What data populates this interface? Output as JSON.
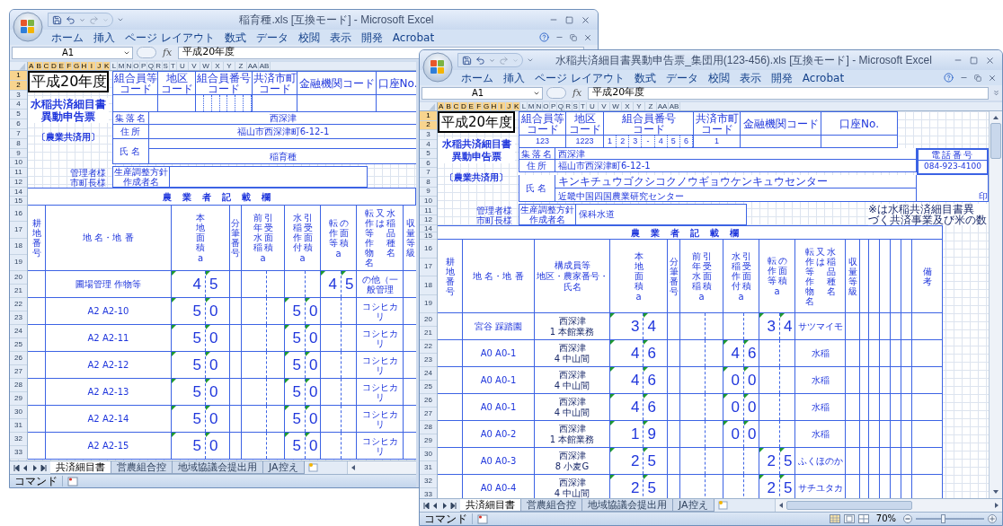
{
  "windows": [
    {
      "title": "稲育種.xls [互換モード] - Microsoft Excel",
      "ribbon_tabs": [
        "ホーム",
        "挿入",
        "ページ レイアウト",
        "数式",
        "データ",
        "校閲",
        "表示",
        "開発",
        "Acrobat"
      ],
      "name_box": "A1",
      "insert_function": "fx",
      "formula": "平成20年度",
      "columns": [
        {
          "label": "A",
          "selected": true
        },
        {
          "label": "B",
          "selected": true
        },
        {
          "label": "C",
          "selected": true
        },
        {
          "label": "D",
          "selected": true
        },
        {
          "label": "E",
          "selected": true
        },
        {
          "label": "F",
          "selected": true
        },
        {
          "label": "G",
          "selected": true
        },
        {
          "label": "H",
          "selected": true
        },
        {
          "label": "I",
          "selected": true
        },
        {
          "label": "J",
          "selected": true
        },
        {
          "label": "K",
          "selected": true
        },
        {
          "label": "L",
          "selected": false
        },
        {
          "label": "M",
          "selected": false
        },
        {
          "label": "N",
          "selected": false
        },
        {
          "label": "O",
          "selected": false
        },
        {
          "label": "P",
          "selected": false
        },
        {
          "label": "Q",
          "selected": false
        },
        {
          "label": "R",
          "selected": false
        },
        {
          "label": "S",
          "selected": false
        },
        {
          "label": "T",
          "selected": false
        },
        {
          "label": "U",
          "selected": false
        },
        {
          "label": "V",
          "selected": false
        },
        {
          "label": "W",
          "selected": false
        },
        {
          "label": "X",
          "selected": false
        },
        {
          "label": "Y",
          "selected": false
        },
        {
          "label": "Z",
          "selected": false
        },
        {
          "label": "AA",
          "selected": false
        },
        {
          "label": "AB",
          "selected": false
        }
      ],
      "sheet": {
        "kind": "individual",
        "header": {
          "rows": [
            {
              "label": "1",
              "selected": true
            },
            {
              "label": "2",
              "selected": true
            },
            {
              "label": "3",
              "selected": false
            },
            {
              "label": "4",
              "selected": false
            },
            {
              "label": "5",
              "selected": false
            },
            {
              "label": "6",
              "selected": false
            },
            {
              "label": "7",
              "selected": false
            },
            {
              "label": "8",
              "selected": false
            },
            {
              "label": "9",
              "selected": false
            },
            {
              "label": "10",
              "selected": false
            },
            {
              "label": "11",
              "selected": false
            },
            {
              "label": "12",
              "selected": false
            }
          ],
          "year": "平成20年度",
          "form_title": [
            "水稲共済細目書",
            "異動申告票"
          ],
          "form_subtitle": "〔農業共済用〕",
          "addressees": [
            "管理者様",
            "市町長様"
          ],
          "codes": [
            {
              "kind": "plain",
              "label": [
                "組合員等",
                "コード"
              ]
            },
            {
              "kind": "plain",
              "label": [
                "地区",
                "コード"
              ]
            },
            {
              "kind": "split",
              "label": [
                "組合員番号",
                "コード"
              ]
            },
            {
              "kind": "plain",
              "label": [
                "共済市町",
                "コード"
              ]
            },
            {
              "kind": "plain",
              "label": [
                "金融機関コード"
              ]
            },
            {
              "kind": "plain",
              "label": [
                "口座No."
              ]
            }
          ],
          "village": {
            "label": "集落名",
            "value": "西深津"
          },
          "address": {
            "label": "住所",
            "value": "福山市西深津町6-12-1"
          },
          "name": {
            "label": "氏名",
            "value": "稲育種"
          },
          "planner": {
            "label": [
              "生産調整方針",
              "作成者名"
            ]
          }
        },
        "title_block": {
          "rows": [
            "14",
            "15"
          ],
          "text": "農業者記載欄"
        },
        "column_headers": {
          "rows": [
            "16",
            "17",
            "18",
            "19"
          ],
          "items": [
            {
              "kind": "blank",
              "cols": [
                "耕地番号"
              ]
            },
            {
              "kind": "text",
              "lines": [
                "地 名・地 番"
              ]
            },
            {
              "kind": "digits",
              "cols": [
                "本地面積"
              ],
              "unit": "a"
            },
            {
              "kind": "blank",
              "cols": [
                "分筆番号"
              ]
            },
            {
              "kind": "digits",
              "cols": [
                "前年水稲",
                "引受面積"
              ],
              "unit": "a"
            },
            {
              "kind": "digits",
              "cols": [
                "水稲作付",
                "引受面積"
              ],
              "unit": "a"
            },
            {
              "kind": "digits",
              "cols": [
                "転作等",
                "の面積"
              ],
              "unit": "a"
            },
            {
              "kind": "text",
              "cols": [
                "転作等作物名",
                "又は",
                "水稲品種名"
              ]
            },
            {
              "kind": "blank",
              "cols": [
                "収量等級"
              ]
            }
          ]
        },
        "records": [
          {
            "rows": [
              "20",
              "21"
            ],
            "place": "圃場管理 作物等",
            "area": [
              "4",
              "5"
            ],
            "converted": [
              "4",
              "5"
            ],
            "crop": "の他（一般管理"
          },
          {
            "rows": [
              "22",
              "23"
            ],
            "place": "A2 A2-10",
            "area": [
              "5",
              "0"
            ],
            "insured": [
              "5",
              "0"
            ],
            "crop": "コシヒカリ"
          },
          {
            "rows": [
              "24",
              "25"
            ],
            "place": "A2 A2-11",
            "area": [
              "5",
              "0"
            ],
            "insured": [
              "5",
              "0"
            ],
            "crop": "コシヒカリ"
          },
          {
            "rows": [
              "26",
              "27"
            ],
            "place": "A2 A2-12",
            "area": [
              "5",
              "0"
            ],
            "insured": [
              "5",
              "0"
            ],
            "crop": "コシヒカリ"
          },
          {
            "rows": [
              "28",
              "29"
            ],
            "place": "A2 A2-13",
            "area": [
              "5",
              "0"
            ],
            "insured": [
              "5",
              "0"
            ],
            "crop": "コシヒカリ"
          },
          {
            "rows": [
              "30",
              "31"
            ],
            "place": "A2 A2-14",
            "area": [
              "5",
              "0"
            ],
            "insured": [
              "5",
              "0"
            ],
            "crop": "コシヒカリ"
          },
          {
            "rows": [
              "32",
              "33"
            ],
            "place": "A2 A2-15",
            "area": [
              "5",
              "0"
            ],
            "insured": [
              "5",
              "0"
            ],
            "crop": "コシヒカリ"
          }
        ]
      },
      "sheet_tabs": [
        {
          "label": "共済細目書",
          "selected": true
        },
        {
          "label": "営農組合控",
          "selected": false
        },
        {
          "label": "地域協議会提出用",
          "selected": false
        },
        {
          "label": "JA控え",
          "selected": false
        }
      ],
      "status": "コマンド"
    },
    {
      "title": "水稲共済細目書異動申告票_集団用(123-456).xls [互換モード] - Microsoft Excel",
      "ribbon_tabs": [
        "ホーム",
        "挿入",
        "ページ レイアウト",
        "数式",
        "データ",
        "校閲",
        "表示",
        "開発",
        "Acrobat"
      ],
      "name_box": "A1",
      "insert_function": "fx",
      "formula": "平成20年度",
      "columns": [
        {
          "label": "A",
          "selected": true
        },
        {
          "label": "B",
          "selected": true
        },
        {
          "label": "C",
          "selected": true
        },
        {
          "label": "D",
          "selected": true
        },
        {
          "label": "E",
          "selected": true
        },
        {
          "label": "F",
          "selected": true
        },
        {
          "label": "G",
          "selected": true
        },
        {
          "label": "H",
          "selected": true
        },
        {
          "label": "I",
          "selected": true
        },
        {
          "label": "J",
          "selected": true
        },
        {
          "label": "K",
          "selected": true
        },
        {
          "label": "L",
          "selected": false
        },
        {
          "label": "M",
          "selected": false
        },
        {
          "label": "N",
          "selected": false
        },
        {
          "label": "O",
          "selected": false
        },
        {
          "label": "P",
          "selected": false
        },
        {
          "label": "Q",
          "selected": false
        },
        {
          "label": "R",
          "selected": false
        },
        {
          "label": "S",
          "selected": false
        },
        {
          "label": "T",
          "selected": false
        },
        {
          "label": "U",
          "selected": false
        },
        {
          "label": "V",
          "selected": false
        },
        {
          "label": "W",
          "selected": false
        },
        {
          "label": "X",
          "selected": false
        },
        {
          "label": "Y",
          "selected": false
        },
        {
          "label": "Z",
          "selected": false
        },
        {
          "label": "AA",
          "selected": false
        },
        {
          "label": "AB",
          "selected": false
        }
      ],
      "sheet": {
        "kind": "group",
        "header": {
          "rows": [
            {
              "label": "1",
              "selected": true
            },
            {
              "label": "2",
              "selected": true
            },
            {
              "label": "3",
              "selected": false
            },
            {
              "label": "4",
              "selected": false
            },
            {
              "label": "5",
              "selected": false
            },
            {
              "label": "6",
              "selected": false
            },
            {
              "label": "7",
              "selected": false
            },
            {
              "label": "8",
              "selected": false
            },
            {
              "label": "9",
              "selected": false
            },
            {
              "label": "10",
              "selected": false
            },
            {
              "label": "11",
              "selected": false
            },
            {
              "label": "12",
              "selected": false
            }
          ],
          "year": "平成20年度",
          "form_title": [
            "水稲共済細目書",
            "異動申告票"
          ],
          "form_subtitle": "〔農業共済用〕",
          "addressees": [
            "管理者様",
            "市町長様"
          ],
          "codes": [
            {
              "kind": "plain",
              "label": [
                "組合員等",
                "コード"
              ],
              "value": "123"
            },
            {
              "kind": "plain",
              "label": [
                "地区",
                "コード"
              ],
              "value": "1223"
            },
            {
              "kind": "split",
              "label": [
                "組合員番号",
                "コード"
              ],
              "digits": [
                "1",
                "2",
                "3",
                "-",
                "4",
                "5",
                "6"
              ]
            },
            {
              "kind": "plain",
              "label": [
                "共済市町",
                "コード"
              ],
              "value": "1"
            },
            {
              "kind": "plain",
              "label": [
                "金融機関コード"
              ]
            },
            {
              "kind": "plain",
              "label": [
                "口座No."
              ]
            }
          ],
          "village": {
            "label": "集落名",
            "value": "西深津"
          },
          "address": {
            "label": "住所",
            "value": "福山市西深津町6-12-1"
          },
          "name": {
            "label": "氏名",
            "kana": "キンキチュウゴクシコクノウギョウケンキュウセンター",
            "value": "近畿中国四国農業研究センター",
            "seal": "印"
          },
          "phone": {
            "label": "電話番号",
            "value": "084-923-4100"
          },
          "planner": {
            "label": [
              "生産調整方針",
              "作成者名"
            ],
            "value": "保科水道"
          },
          "note": [
            "※は水稲共済細目書異",
            "づく共済事業及び米の数"
          ]
        },
        "title_block": {
          "rows": [
            "14",
            "15"
          ],
          "text": "農業者記載欄"
        },
        "column_headers": {
          "rows": [
            "16",
            "17",
            "18",
            "19"
          ],
          "items": [
            {
              "kind": "blank",
              "cols": [
                "耕地番号"
              ]
            },
            {
              "kind": "text",
              "lines": [
                "地 名・地 番"
              ]
            },
            {
              "kind": "lines",
              "lines": [
                "構成員等",
                "地区・農家番号・",
                "氏名"
              ]
            },
            {
              "kind": "digits",
              "cols": [
                "本地面積"
              ],
              "unit": "a"
            },
            {
              "kind": "blank",
              "cols": [
                "分筆番号"
              ]
            },
            {
              "kind": "digits",
              "cols": [
                "前年水稲",
                "引受面積"
              ],
              "unit": "a"
            },
            {
              "kind": "digits",
              "cols": [
                "水稲作付",
                "引受面積"
              ],
              "unit": "a"
            },
            {
              "kind": "digits",
              "cols": [
                "転作等",
                "の面積"
              ],
              "unit": "a"
            },
            {
              "kind": "text",
              "cols": [
                "転作等作物名",
                "又は",
                "水稲品種名"
              ]
            },
            {
              "kind": "blank",
              "cols": [
                "収量等級"
              ]
            },
            {
              "kind": "blank"
            },
            {
              "kind": "blank"
            },
            {
              "kind": "blank"
            },
            {
              "kind": "blank"
            },
            {
              "kind": "blank"
            },
            {
              "kind": "blank",
              "cols": [
                "備考"
              ]
            }
          ]
        },
        "records": [
          {
            "rows": [
              "20",
              "21"
            ],
            "place": "宮谷 踩踏園",
            "member": [
              "西深津",
              "1 本館業務"
            ],
            "area": [
              "3",
              "4"
            ],
            "converted": [
              "3",
              "4"
            ],
            "crop": "サツマイモ"
          },
          {
            "rows": [
              "22",
              "23"
            ],
            "place": "A0 A0-1",
            "member": [
              "西深津",
              "4 中山間"
            ],
            "area": [
              "4",
              "6"
            ],
            "insured": [
              "4",
              "6"
            ],
            "crop": "水稲"
          },
          {
            "rows": [
              "24",
              "25"
            ],
            "place": "A0 A0-1",
            "member": [
              "西深津",
              "4 中山間"
            ],
            "area": [
              "4",
              "6"
            ],
            "insured": [
              "0",
              "0"
            ],
            "crop": "水稲"
          },
          {
            "rows": [
              "26",
              "27"
            ],
            "place": "A0 A0-1",
            "member": [
              "西深津",
              "4 中山間"
            ],
            "area": [
              "4",
              "6"
            ],
            "insured": [
              "0",
              "0"
            ],
            "crop": "水稲"
          },
          {
            "rows": [
              "28",
              "29"
            ],
            "place": "A0 A0-2",
            "member": [
              "西深津",
              "1 本館業務"
            ],
            "area": [
              "1",
              "9"
            ],
            "insured": [
              "0",
              "0"
            ],
            "crop": "水稲"
          },
          {
            "rows": [
              "30",
              "31"
            ],
            "place": "A0 A0-3",
            "member": [
              "西深津",
              "8 小麦G"
            ],
            "area": [
              "2",
              "5"
            ],
            "converted": [
              "2",
              "5"
            ],
            "crop": "ふくほのか"
          },
          {
            "rows": [
              "32",
              "33"
            ],
            "place": "A0 A0-4",
            "member": [
              "西深津",
              "4 中山間"
            ],
            "area": [
              "2",
              "5"
            ],
            "converted": [
              "2",
              "5"
            ],
            "crop": "サチユタカ"
          }
        ]
      },
      "sheet_tabs": [
        {
          "label": "共済細目書",
          "selected": true
        },
        {
          "label": "営農組合控",
          "selected": false
        },
        {
          "label": "地域協議会提出用",
          "selected": false
        },
        {
          "label": "JA控え",
          "selected": false
        }
      ],
      "status": "コマンド",
      "zoom": "70%",
      "zoom_slider": {
        "level": 0.4
      }
    }
  ]
}
